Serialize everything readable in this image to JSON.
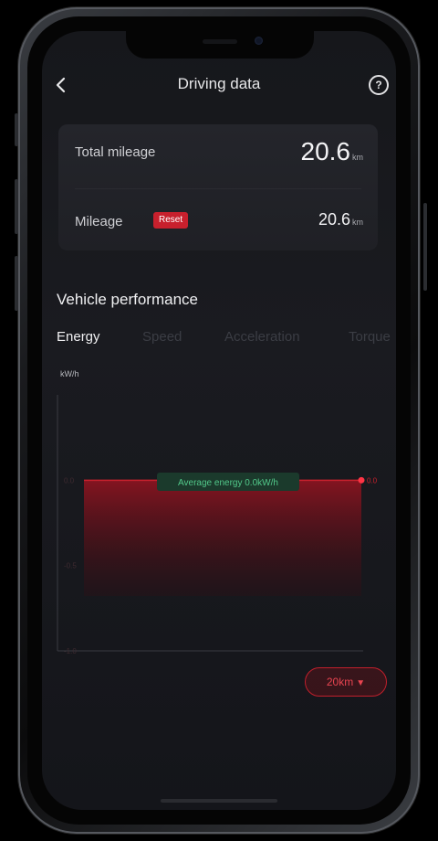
{
  "header": {
    "title": "Driving data",
    "back_icon": "chevron-left-icon",
    "help_icon": "question-circle-icon"
  },
  "mileage": {
    "total_label": "Total mileage",
    "total_value": "20.6",
    "total_unit": "km",
    "mileage_label": "Mileage",
    "reset_label": "Reset",
    "mileage_value": "20.6",
    "mileage_unit": "km"
  },
  "performance": {
    "title": "Vehicle performance",
    "tabs": [
      "Energy",
      "Speed",
      "Acceleration",
      "Torque"
    ],
    "active_tab": "Energy",
    "range_label": "20km",
    "range_icon": "chevron-down-icon"
  },
  "colors": {
    "accent": "#c8202d",
    "background": "#16171b",
    "card": "#222328",
    "tooltip_bg": "#1b3a2c",
    "tooltip_text": "#52c88a"
  },
  "chart_data": {
    "type": "area",
    "ylabel": "kW/h",
    "yticks": [
      "0.0",
      "-0.5",
      "-1.0"
    ],
    "x": [
      0,
      20
    ],
    "values": [
      0.0,
      0.0
    ],
    "end_label": "0.0",
    "ylim": [
      -1.0,
      0.5
    ],
    "annotation": "Average energy 0.0kW/h",
    "grid": false,
    "series_color": "#c8202d"
  }
}
